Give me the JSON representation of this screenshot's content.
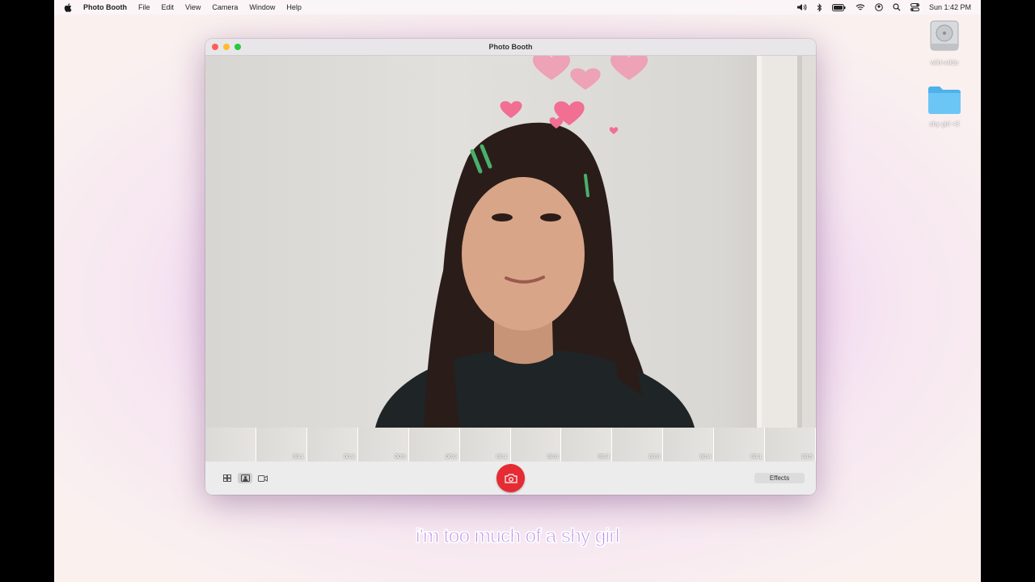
{
  "menubar": {
    "app": "Photo Booth",
    "items": [
      "File",
      "Edit",
      "View",
      "Camera",
      "Window",
      "Help"
    ],
    "clock": "Sun 1:42 PM",
    "status_icons": [
      "volume-icon",
      "bluetooth-icon",
      "battery-icon",
      "wifi-icon",
      "user-icon",
      "search-icon",
      "control-center-icon"
    ]
  },
  "desktop": {
    "icons": [
      {
        "label": "wild-wilde",
        "icon": "hard-drive-icon"
      },
      {
        "label": "shy girl <3",
        "icon": "folder-icon"
      }
    ]
  },
  "window": {
    "title": "Photo Booth",
    "effects_label": "Effects",
    "thumbnails": [
      "",
      "00:1",
      "00:3",
      "00:0",
      "00:0",
      "00:1",
      "00:0",
      "00:3",
      "00:0",
      "00:4",
      "00:1",
      "00:5"
    ]
  },
  "caption": "i'm too much of a shy girl",
  "colors": {
    "shutter": "#e52b33",
    "caption": "#b48de6"
  }
}
